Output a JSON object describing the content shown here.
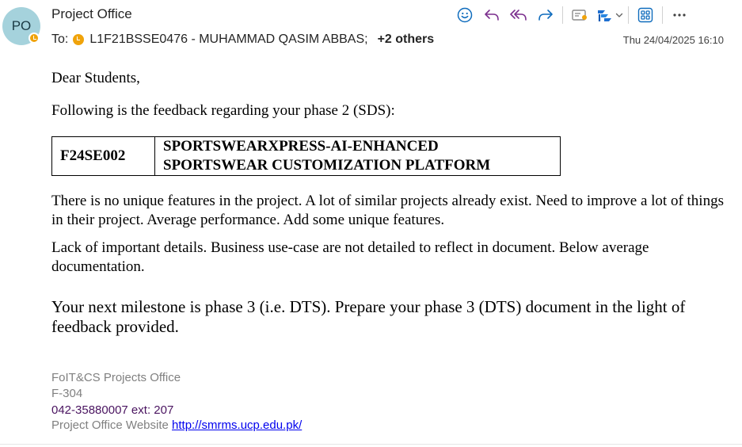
{
  "message": {
    "avatar_initials": "PO",
    "sender": "Project Office",
    "to_label": "To:",
    "recipient": "L1F21BSSE0476 - MUHAMMAD QASIM ABBAS;",
    "others": "+2 others",
    "datetime": "Thu 24/04/2025 16:10"
  },
  "toolbar": {
    "icons": [
      "emoji-icon",
      "reply-icon",
      "reply-all-icon",
      "forward-icon",
      "view-icon",
      "apps-icon",
      "chevron-down-icon",
      "grid-icon",
      "more-icon"
    ],
    "accent": "#0f6cbd",
    "reply_accent": "#7b2f8e"
  },
  "body": {
    "greeting": "Dear Students,",
    "intro": "Following is the feedback regarding your phase 2 (SDS):",
    "table": {
      "code": "F24SE002",
      "title_line1": "SPORTSWEARXPRESS-AI-ENHANCED",
      "title_line2": "SPORTSWEAR CUSTOMIZATION PLATFORM"
    },
    "para1": "There is no unique features in the project. A lot of similar projects already exist. Need to improve a lot of things in their project. Average performance. Add some unique features.",
    "para2": "Lack of important details. Business use-case are not detailed to reflect in document. Below average documentation.",
    "para3": "Your next milestone is phase 3 (i.e. DTS). Prepare your phase 3 (DTS) document in the light of feedback provided."
  },
  "signature": {
    "office": "FoIT&CS Projects Office",
    "room": "F-304",
    "phone": "042-35880007 ext: 207",
    "website_label": "Project Office Website",
    "website_url": "http://smrms.ucp.edu.pk/"
  }
}
